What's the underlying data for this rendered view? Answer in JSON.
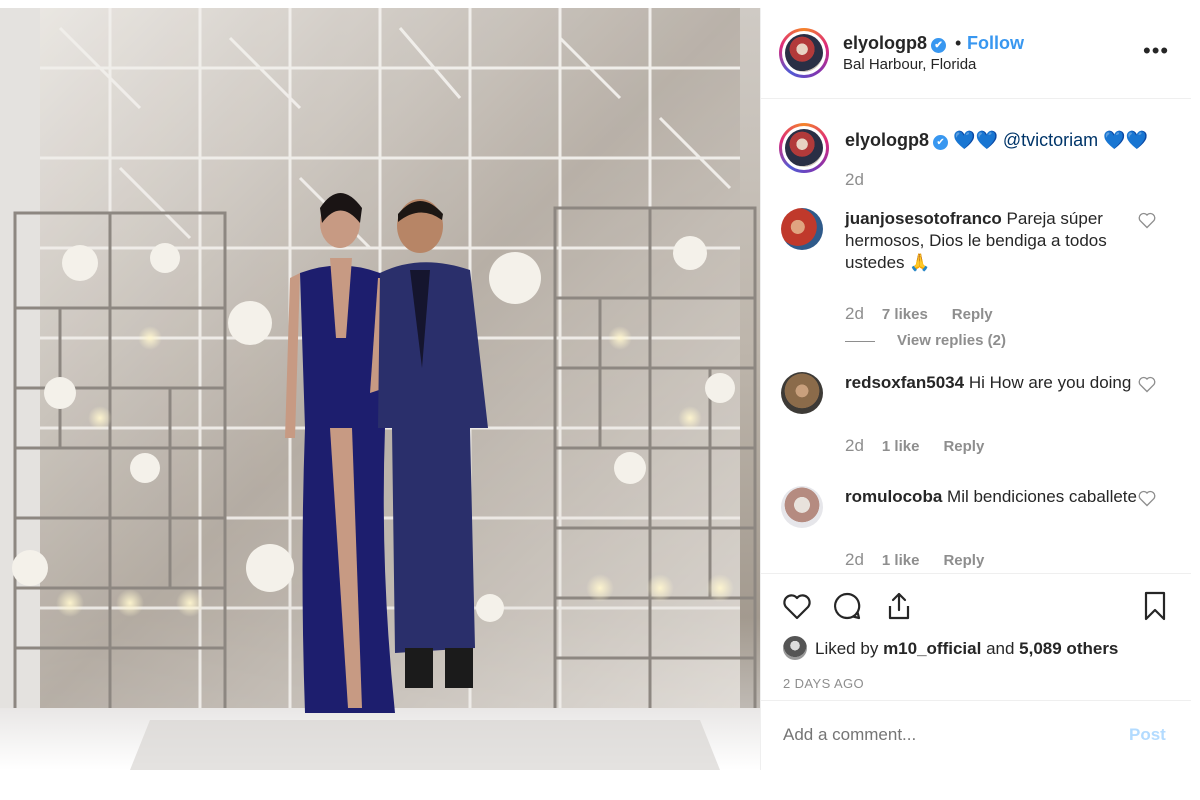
{
  "header": {
    "username": "elyologp8",
    "verified_mark": "✔",
    "separator": "•",
    "follow_label": "Follow",
    "location": "Bal Harbour, Florida",
    "more_icon": "more-icon"
  },
  "caption": {
    "username": "elyologp8",
    "hearts_before": "💙💙",
    "mention": "@tvictoriam",
    "hearts_after": "💙💙",
    "time": "2d"
  },
  "comments": [
    {
      "username": "juanjosesotofranco",
      "text": "Pareja súper hermosos, Dios le bendiga a todos ustedes 🙏",
      "time": "2d",
      "likes": "7 likes",
      "reply": "Reply",
      "view_replies": "View replies (2)"
    },
    {
      "username": "redsoxfan5034",
      "text": "Hi How are you doing",
      "time": "2d",
      "likes": "1 like",
      "reply": "Reply"
    },
    {
      "username": "romulocoba",
      "text": "Mil bendiciones caballete",
      "time": "2d",
      "likes": "1 like",
      "reply": "Reply"
    }
  ],
  "actions": {
    "liked_prefix": "Liked by",
    "liked_user": "m10_official",
    "liked_and": "and",
    "liked_others": "5,089 others",
    "date": "2 DAYS AGO"
  },
  "add_comment": {
    "placeholder": "Add a comment...",
    "post_label": "Post"
  },
  "colors": {
    "link": "#3897f0",
    "muted": "#8e8e8e",
    "text": "#262626",
    "post_disabled": "#b3dbff",
    "suit": "#2a2f6b",
    "dress": "#1d1e6e"
  }
}
